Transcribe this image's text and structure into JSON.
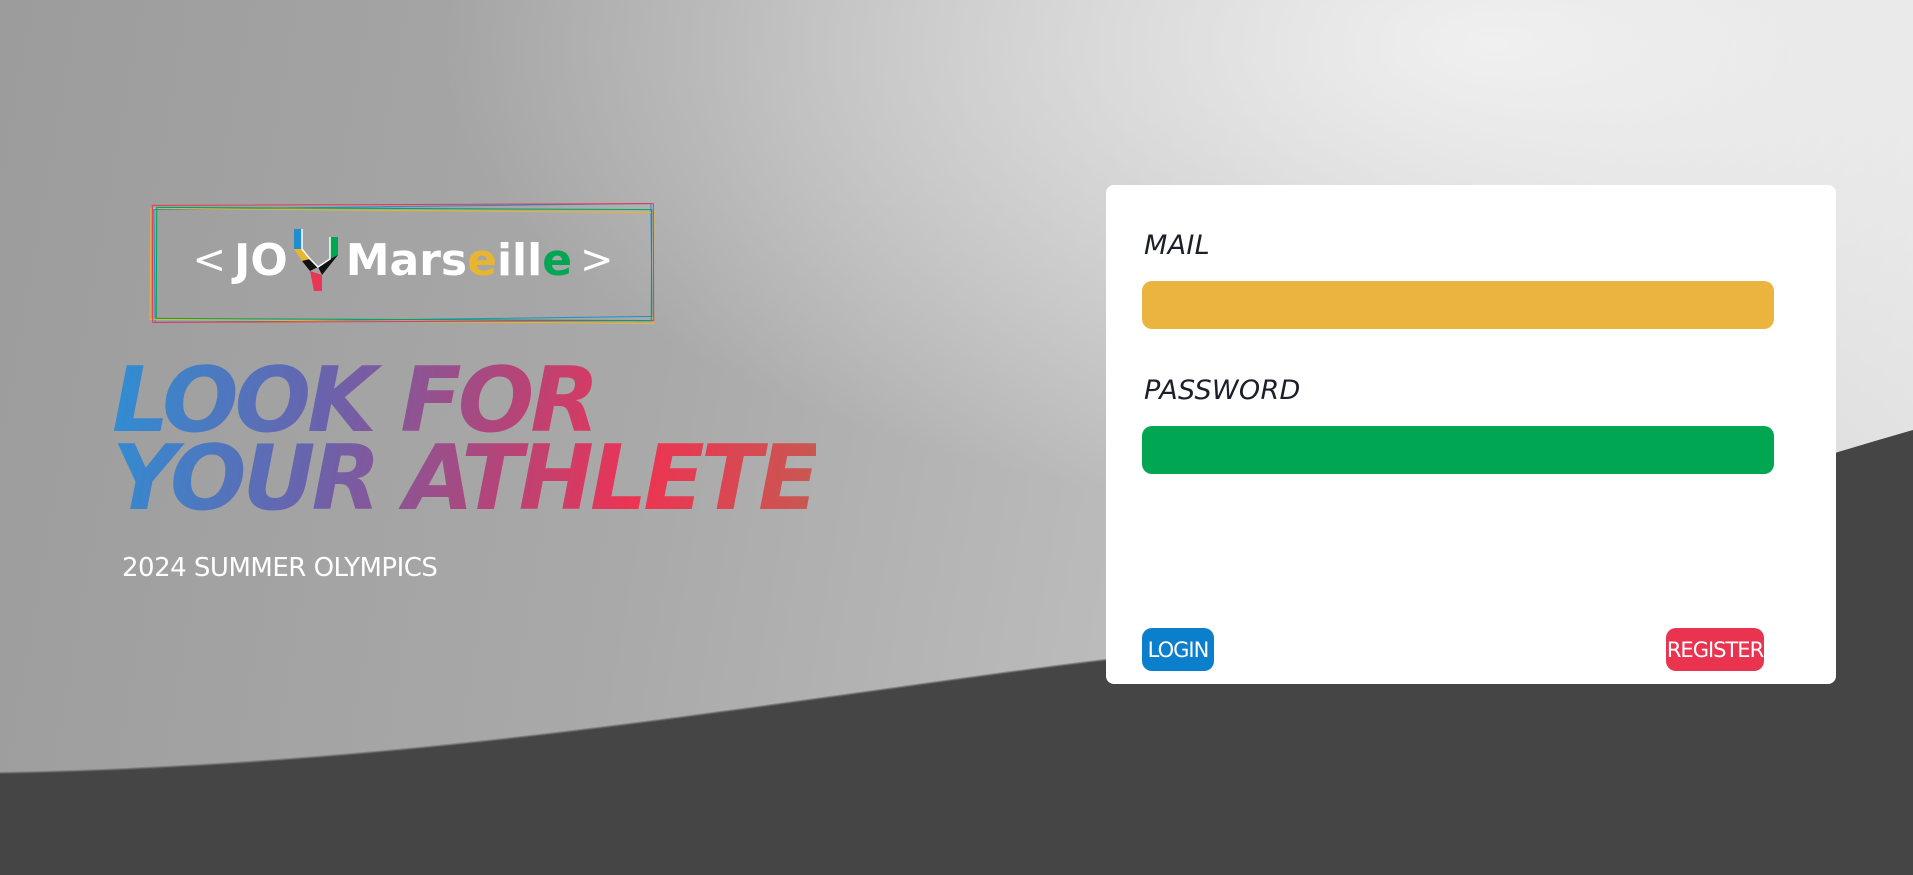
{
  "brand": {
    "open_bracket": "<",
    "jo": "JO",
    "name_start": "Mars",
    "name_e1": "e",
    "name_mid": "ill",
    "name_e2": "e",
    "close_bracket": ">",
    "frame_colors": [
      "#1f8fd0",
      "#e8b531",
      "#ea3556",
      "#00a651"
    ],
    "mark_icon": "olympic-ribbon-icon"
  },
  "hero": {
    "line1": "LOOK FOR",
    "line2": "YOUR ATHLETE",
    "subtitle": "2024 SUMMER OLYMPICS"
  },
  "login_form": {
    "mail_label": "MAIL",
    "mail_value": "",
    "password_label": "PASSWORD",
    "password_value": "",
    "login_button": "LOGIN",
    "register_button": "REGISTER"
  },
  "colors": {
    "mail_field": "#ebb43e",
    "password_field": "#00a651",
    "login_button": "#0b7fcc",
    "register_button": "#e9334f",
    "headline_gradient": [
      "#2e8fd4",
      "#6a62ac",
      "#b3457a",
      "#ee3352",
      "#c65a52"
    ]
  }
}
